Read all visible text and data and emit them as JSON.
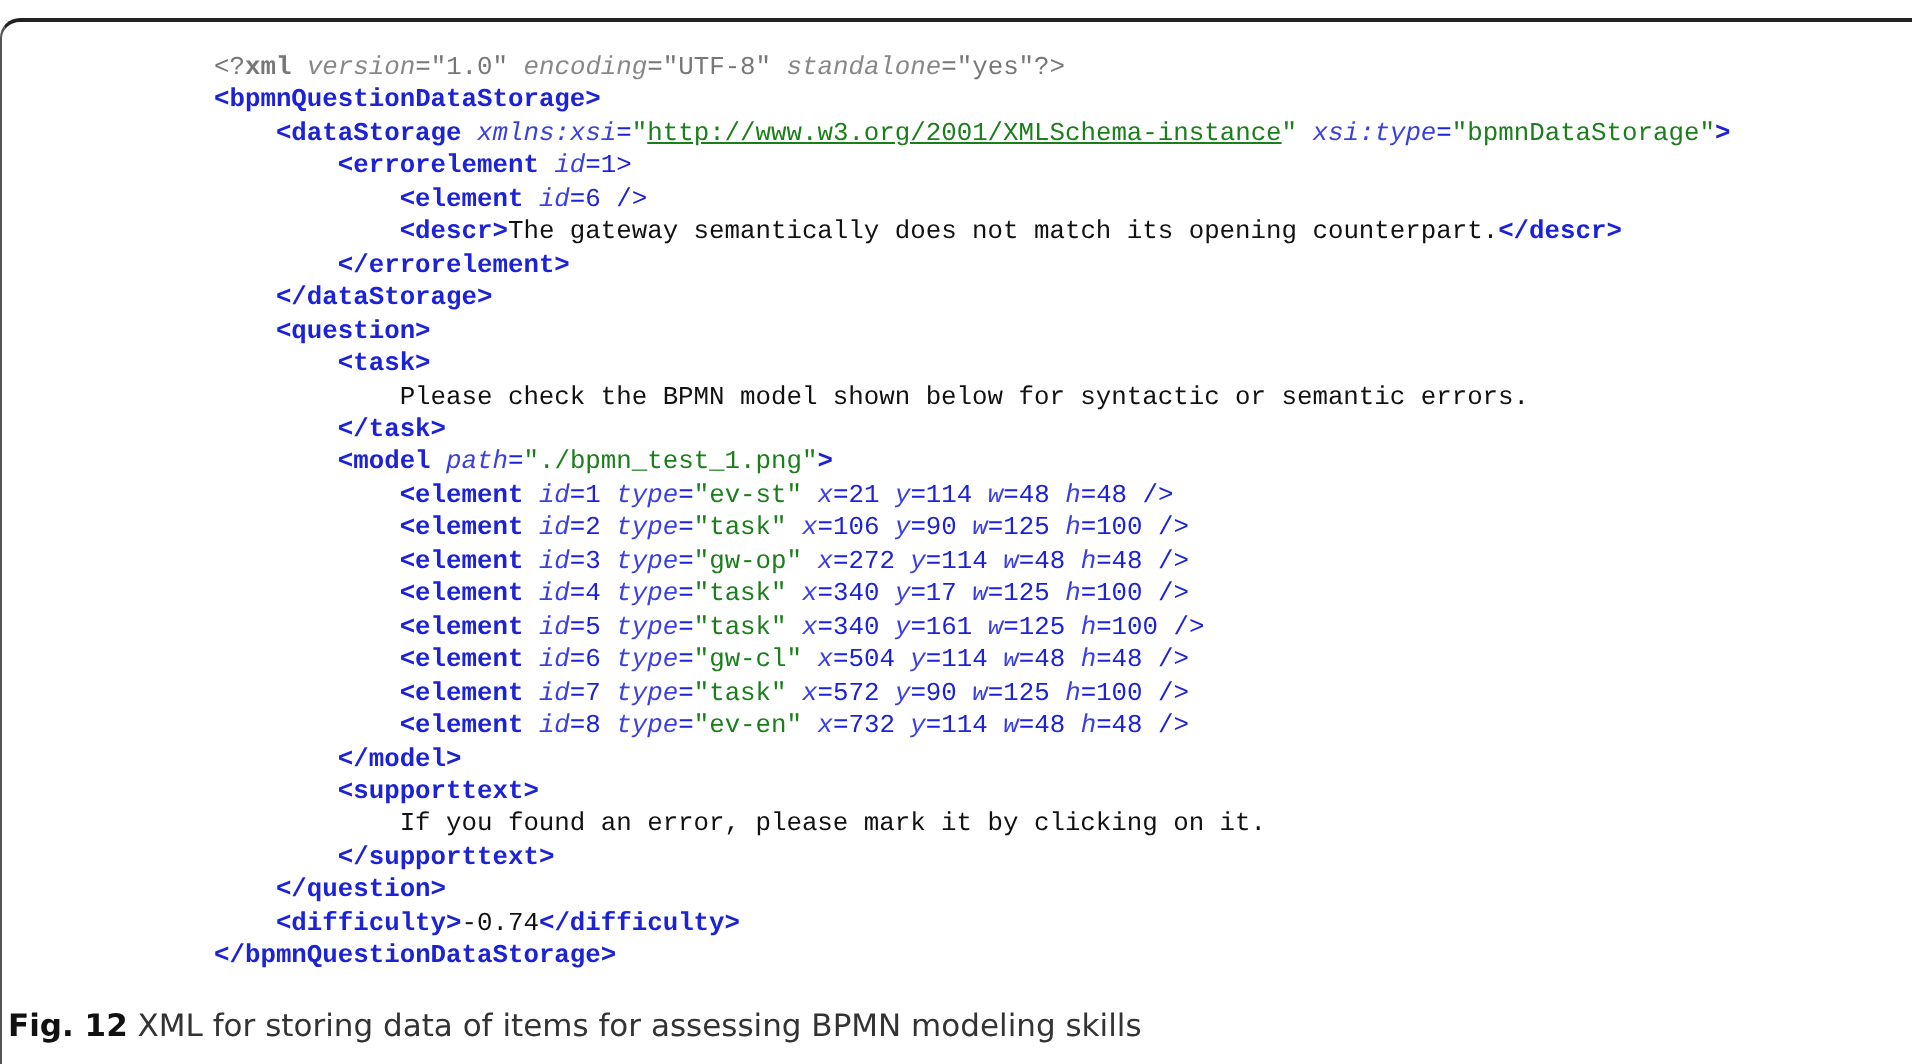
{
  "listing": [
    {
      "tokens": [
        {
          "kind": "decl",
          "text": "<?"
        },
        {
          "kind": "declkw",
          "text": "xml"
        },
        {
          "kind": "declattr",
          "text": " version"
        },
        {
          "kind": "decl",
          "text": "=\"1.0\" "
        },
        {
          "kind": "declattr",
          "text": "encoding"
        },
        {
          "kind": "decl",
          "text": "=\"UTF-8\" "
        },
        {
          "kind": "declattr",
          "text": "standalone"
        },
        {
          "kind": "decl",
          "text": "=\"yes\"?>"
        }
      ]
    },
    {
      "tokens": [
        {
          "kind": "tag",
          "text": "<bpmnQuestionDataStorage>"
        }
      ],
      "children": [
        {
          "tokens": [
            {
              "kind": "tag",
              "text": "<dataStorage"
            },
            {
              "kind": "attr",
              "text": " xmlns:xsi"
            },
            {
              "kind": "punct",
              "text": "="
            },
            {
              "kind": "str",
              "text": "\""
            },
            {
              "kind": "link",
              "text": "http://www.w3.org/2001/XMLSchema-instance"
            },
            {
              "kind": "str",
              "text": "\""
            },
            {
              "kind": "attr",
              "text": " xsi:type"
            },
            {
              "kind": "punct",
              "text": "="
            },
            {
              "kind": "str",
              "text": "\"bpmnDataStorage\""
            },
            {
              "kind": "tag",
              "text": ">"
            }
          ],
          "children": [
            {
              "tokens": [
                {
                  "kind": "tag",
                  "text": "<errorelement"
                },
                {
                  "kind": "attr",
                  "text": " id"
                },
                {
                  "kind": "punct",
                  "text": "=1>"
                }
              ],
              "children": [
                {
                  "tokens": [
                    {
                      "kind": "tag",
                      "text": "<element"
                    },
                    {
                      "kind": "attr",
                      "text": " id"
                    },
                    {
                      "kind": "punct",
                      "text": "=6 />"
                    }
                  ]
                },
                {
                  "tokens": [
                    {
                      "kind": "tag",
                      "text": "<descr>"
                    },
                    {
                      "kind": "text",
                      "text": "The gateway semantically does not match its opening counterpart."
                    },
                    {
                      "kind": "tag",
                      "text": "</descr>"
                    }
                  ]
                }
              ]
            },
            {
              "tokens": [
                {
                  "kind": "tag",
                  "text": "</errorelement>"
                }
              ]
            }
          ]
        },
        {
          "tokens": [
            {
              "kind": "tag",
              "text": "</dataStorage>"
            }
          ]
        },
        {
          "tokens": [
            {
              "kind": "tag",
              "text": "<question>"
            }
          ],
          "children": [
            {
              "tokens": [
                {
                  "kind": "tag",
                  "text": "<task>"
                }
              ],
              "children": [
                {
                  "tokens": [
                    {
                      "kind": "text",
                      "text": "Please check the BPMN model shown below for syntactic or semantic errors."
                    }
                  ]
                }
              ]
            },
            {
              "tokens": [
                {
                  "kind": "tag",
                  "text": "</task>"
                }
              ]
            },
            {
              "tokens": [
                {
                  "kind": "tag",
                  "text": "<model"
                },
                {
                  "kind": "attr",
                  "text": " path"
                },
                {
                  "kind": "punct",
                  "text": "="
                },
                {
                  "kind": "str",
                  "text": "\"./bpmn_test_1.png\""
                },
                {
                  "kind": "tag",
                  "text": ">"
                }
              ],
              "children": [
                {
                  "tokens": [
                    {
                      "kind": "tag",
                      "text": "<element"
                    },
                    {
                      "kind": "attr",
                      "text": " id"
                    },
                    {
                      "kind": "punct",
                      "text": "=1 "
                    },
                    {
                      "kind": "attr",
                      "text": "type"
                    },
                    {
                      "kind": "punct",
                      "text": "="
                    },
                    {
                      "kind": "str",
                      "text": "\"ev-st\""
                    },
                    {
                      "kind": "attr",
                      "text": " x"
                    },
                    {
                      "kind": "punct",
                      "text": "=21 "
                    },
                    {
                      "kind": "attr",
                      "text": "y"
                    },
                    {
                      "kind": "punct",
                      "text": "=114 "
                    },
                    {
                      "kind": "attr",
                      "text": "w"
                    },
                    {
                      "kind": "punct",
                      "text": "=48 "
                    },
                    {
                      "kind": "attr",
                      "text": "h"
                    },
                    {
                      "kind": "punct",
                      "text": "=48 />"
                    }
                  ]
                },
                {
                  "tokens": [
                    {
                      "kind": "tag",
                      "text": "<element"
                    },
                    {
                      "kind": "attr",
                      "text": " id"
                    },
                    {
                      "kind": "punct",
                      "text": "=2 "
                    },
                    {
                      "kind": "attr",
                      "text": "type"
                    },
                    {
                      "kind": "punct",
                      "text": "="
                    },
                    {
                      "kind": "str",
                      "text": "\"task\""
                    },
                    {
                      "kind": "attr",
                      "text": " x"
                    },
                    {
                      "kind": "punct",
                      "text": "=106 "
                    },
                    {
                      "kind": "attr",
                      "text": "y"
                    },
                    {
                      "kind": "punct",
                      "text": "=90 "
                    },
                    {
                      "kind": "attr",
                      "text": "w"
                    },
                    {
                      "kind": "punct",
                      "text": "=125 "
                    },
                    {
                      "kind": "attr",
                      "text": "h"
                    },
                    {
                      "kind": "punct",
                      "text": "=100 />"
                    }
                  ]
                },
                {
                  "tokens": [
                    {
                      "kind": "tag",
                      "text": "<element"
                    },
                    {
                      "kind": "attr",
                      "text": " id"
                    },
                    {
                      "kind": "punct",
                      "text": "=3 "
                    },
                    {
                      "kind": "attr",
                      "text": "type"
                    },
                    {
                      "kind": "punct",
                      "text": "="
                    },
                    {
                      "kind": "str",
                      "text": "\"gw-op\""
                    },
                    {
                      "kind": "attr",
                      "text": " x"
                    },
                    {
                      "kind": "punct",
                      "text": "=272 "
                    },
                    {
                      "kind": "attr",
                      "text": "y"
                    },
                    {
                      "kind": "punct",
                      "text": "=114 "
                    },
                    {
                      "kind": "attr",
                      "text": "w"
                    },
                    {
                      "kind": "punct",
                      "text": "=48 "
                    },
                    {
                      "kind": "attr",
                      "text": "h"
                    },
                    {
                      "kind": "punct",
                      "text": "=48 />"
                    }
                  ]
                },
                {
                  "tokens": [
                    {
                      "kind": "tag",
                      "text": "<element"
                    },
                    {
                      "kind": "attr",
                      "text": " id"
                    },
                    {
                      "kind": "punct",
                      "text": "=4 "
                    },
                    {
                      "kind": "attr",
                      "text": "type"
                    },
                    {
                      "kind": "punct",
                      "text": "="
                    },
                    {
                      "kind": "str",
                      "text": "\"task\""
                    },
                    {
                      "kind": "attr",
                      "text": " x"
                    },
                    {
                      "kind": "punct",
                      "text": "=340 "
                    },
                    {
                      "kind": "attr",
                      "text": "y"
                    },
                    {
                      "kind": "punct",
                      "text": "=17 "
                    },
                    {
                      "kind": "attr",
                      "text": "w"
                    },
                    {
                      "kind": "punct",
                      "text": "=125 "
                    },
                    {
                      "kind": "attr",
                      "text": "h"
                    },
                    {
                      "kind": "punct",
                      "text": "=100 />"
                    }
                  ]
                },
                {
                  "tokens": [
                    {
                      "kind": "tag",
                      "text": "<element"
                    },
                    {
                      "kind": "attr",
                      "text": " id"
                    },
                    {
                      "kind": "punct",
                      "text": "=5 "
                    },
                    {
                      "kind": "attr",
                      "text": "type"
                    },
                    {
                      "kind": "punct",
                      "text": "="
                    },
                    {
                      "kind": "str",
                      "text": "\"task\""
                    },
                    {
                      "kind": "attr",
                      "text": " x"
                    },
                    {
                      "kind": "punct",
                      "text": "=340 "
                    },
                    {
                      "kind": "attr",
                      "text": "y"
                    },
                    {
                      "kind": "punct",
                      "text": "=161 "
                    },
                    {
                      "kind": "attr",
                      "text": "w"
                    },
                    {
                      "kind": "punct",
                      "text": "=125 "
                    },
                    {
                      "kind": "attr",
                      "text": "h"
                    },
                    {
                      "kind": "punct",
                      "text": "=100 />"
                    }
                  ]
                },
                {
                  "tokens": [
                    {
                      "kind": "tag",
                      "text": "<element"
                    },
                    {
                      "kind": "attr",
                      "text": " id"
                    },
                    {
                      "kind": "punct",
                      "text": "=6 "
                    },
                    {
                      "kind": "attr",
                      "text": "type"
                    },
                    {
                      "kind": "punct",
                      "text": "="
                    },
                    {
                      "kind": "str",
                      "text": "\"gw-cl\""
                    },
                    {
                      "kind": "attr",
                      "text": " x"
                    },
                    {
                      "kind": "punct",
                      "text": "=504 "
                    },
                    {
                      "kind": "attr",
                      "text": "y"
                    },
                    {
                      "kind": "punct",
                      "text": "=114 "
                    },
                    {
                      "kind": "attr",
                      "text": "w"
                    },
                    {
                      "kind": "punct",
                      "text": "=48 "
                    },
                    {
                      "kind": "attr",
                      "text": "h"
                    },
                    {
                      "kind": "punct",
                      "text": "=48 />"
                    }
                  ]
                },
                {
                  "tokens": [
                    {
                      "kind": "tag",
                      "text": "<element"
                    },
                    {
                      "kind": "attr",
                      "text": " id"
                    },
                    {
                      "kind": "punct",
                      "text": "=7 "
                    },
                    {
                      "kind": "attr",
                      "text": "type"
                    },
                    {
                      "kind": "punct",
                      "text": "="
                    },
                    {
                      "kind": "str",
                      "text": "\"task\""
                    },
                    {
                      "kind": "attr",
                      "text": " x"
                    },
                    {
                      "kind": "punct",
                      "text": "=572 "
                    },
                    {
                      "kind": "attr",
                      "text": "y"
                    },
                    {
                      "kind": "punct",
                      "text": "=90 "
                    },
                    {
                      "kind": "attr",
                      "text": "w"
                    },
                    {
                      "kind": "punct",
                      "text": "=125 "
                    },
                    {
                      "kind": "attr",
                      "text": "h"
                    },
                    {
                      "kind": "punct",
                      "text": "=100 />"
                    }
                  ]
                },
                {
                  "tokens": [
                    {
                      "kind": "tag",
                      "text": "<element"
                    },
                    {
                      "kind": "attr",
                      "text": " id"
                    },
                    {
                      "kind": "punct",
                      "text": "=8 "
                    },
                    {
                      "kind": "attr",
                      "text": "type"
                    },
                    {
                      "kind": "punct",
                      "text": "="
                    },
                    {
                      "kind": "str",
                      "text": "\"ev-en\""
                    },
                    {
                      "kind": "attr",
                      "text": " x"
                    },
                    {
                      "kind": "punct",
                      "text": "=732 "
                    },
                    {
                      "kind": "attr",
                      "text": "y"
                    },
                    {
                      "kind": "punct",
                      "text": "=114 "
                    },
                    {
                      "kind": "attr",
                      "text": "w"
                    },
                    {
                      "kind": "punct",
                      "text": "=48 "
                    },
                    {
                      "kind": "attr",
                      "text": "h"
                    },
                    {
                      "kind": "punct",
                      "text": "=48 />"
                    }
                  ]
                }
              ]
            },
            {
              "tokens": [
                {
                  "kind": "tag",
                  "text": "</model>"
                }
              ]
            },
            {
              "tokens": [
                {
                  "kind": "tag",
                  "text": "<supporttext>"
                }
              ],
              "children": [
                {
                  "tokens": [
                    {
                      "kind": "text",
                      "text": "If you found an error, please mark it by clicking on it."
                    }
                  ]
                }
              ]
            },
            {
              "tokens": [
                {
                  "kind": "tag",
                  "text": "</supporttext>"
                }
              ]
            }
          ]
        },
        {
          "tokens": [
            {
              "kind": "tag",
              "text": "</question>"
            }
          ]
        },
        {
          "tokens": [
            {
              "kind": "tag",
              "text": "<difficulty>"
            },
            {
              "kind": "text",
              "text": "-0.74"
            },
            {
              "kind": "tag",
              "text": "</difficulty>"
            }
          ]
        }
      ]
    },
    {
      "tokens": [
        {
          "kind": "tag",
          "text": "</bpmnQuestionDataStorage>"
        }
      ]
    }
  ],
  "caption": "**Fig. 12** XML for storing data of items for assessing BPMN modeling skills"
}
